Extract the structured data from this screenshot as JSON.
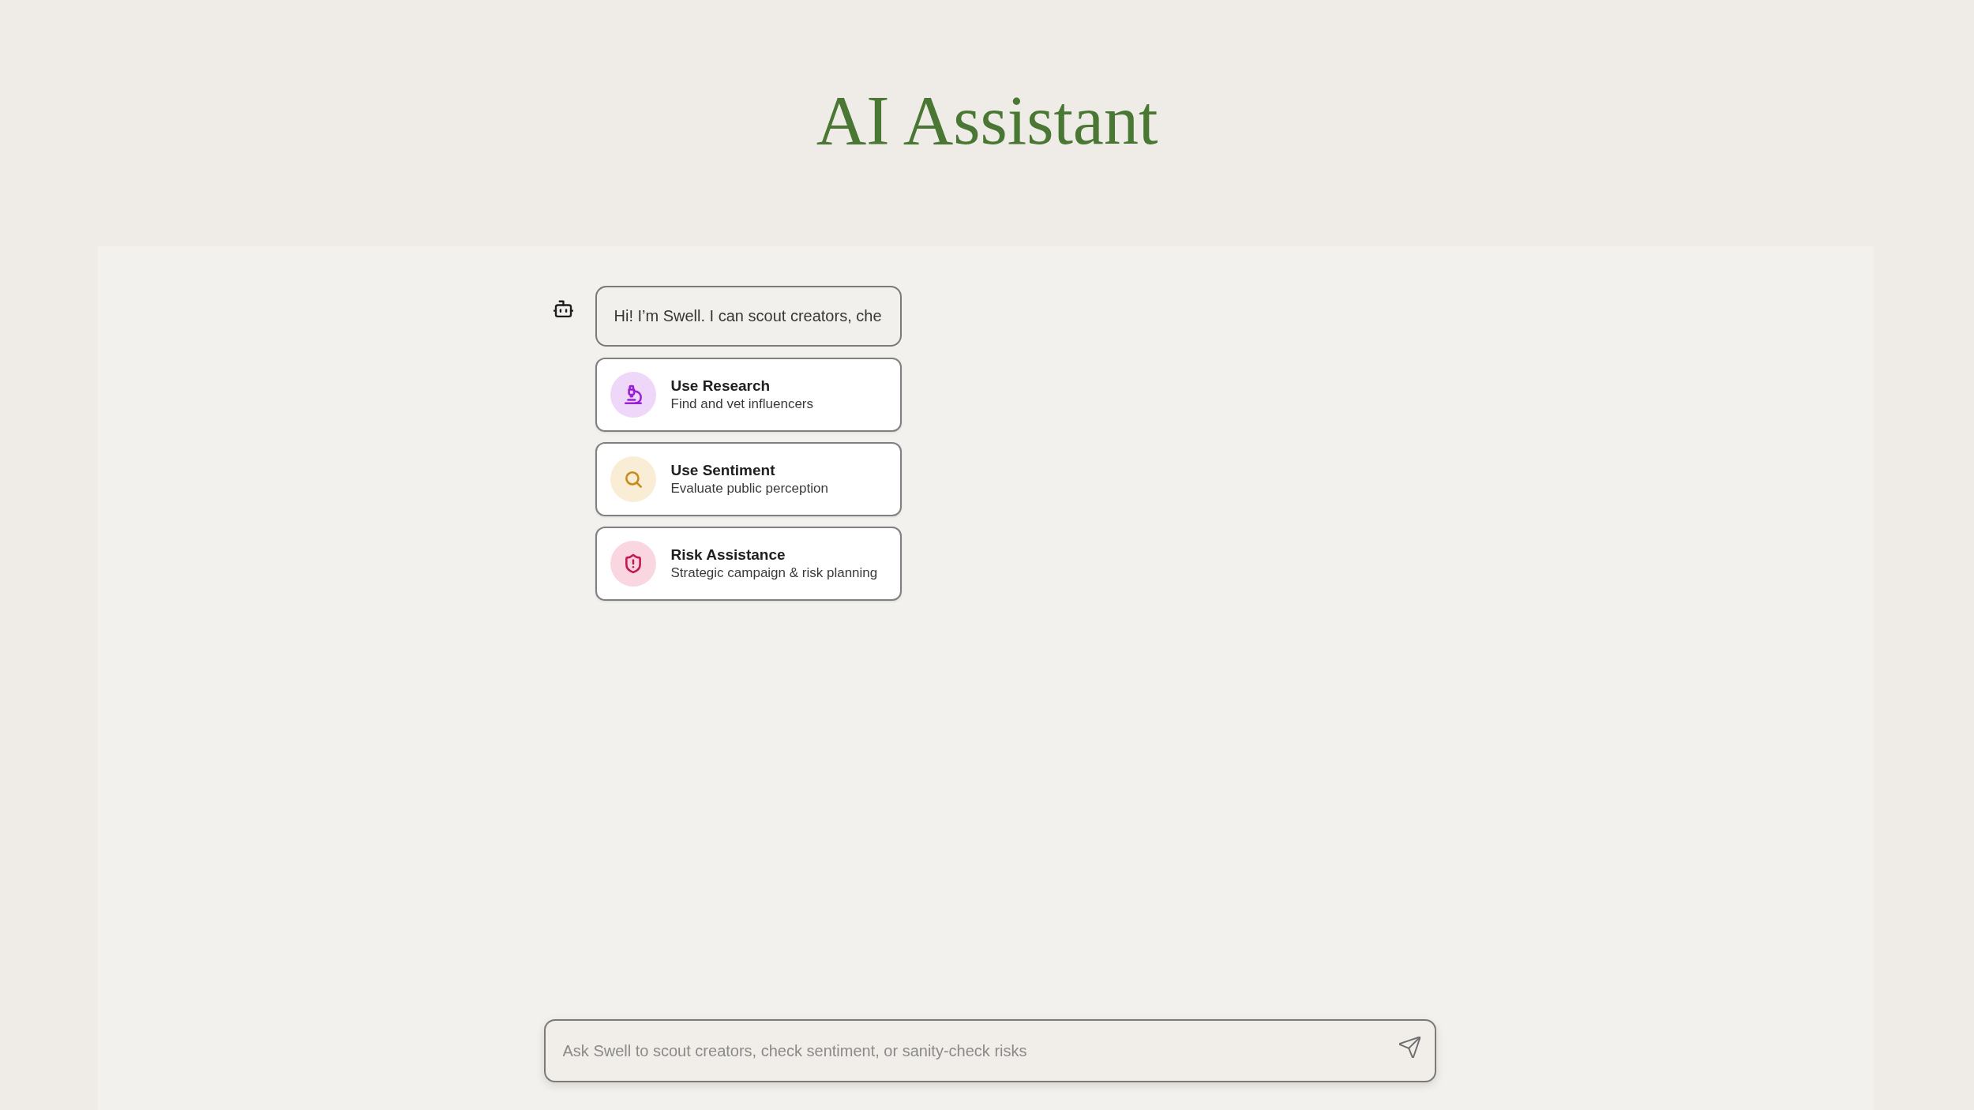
{
  "page": {
    "title": "AI Assistant"
  },
  "chat": {
    "messages": [
      {
        "text": "Hi! I’m Swell. I can scout creators, che"
      }
    ],
    "actions": [
      {
        "kind": "research",
        "title": "Use Research",
        "subtitle": "Find and vet influencers",
        "color": "#9b1fd6"
      },
      {
        "kind": "sentiment",
        "title": "Use Sentiment",
        "subtitle": "Evaluate public perception",
        "color": "#c98a1a"
      },
      {
        "kind": "risk",
        "title": "Risk Assistance",
        "subtitle": "Strategic campaign & risk planning",
        "color": "#c8174e"
      }
    ]
  },
  "composer": {
    "placeholder": "Ask Swell to scout creators, check sentiment, or sanity-check risks"
  }
}
